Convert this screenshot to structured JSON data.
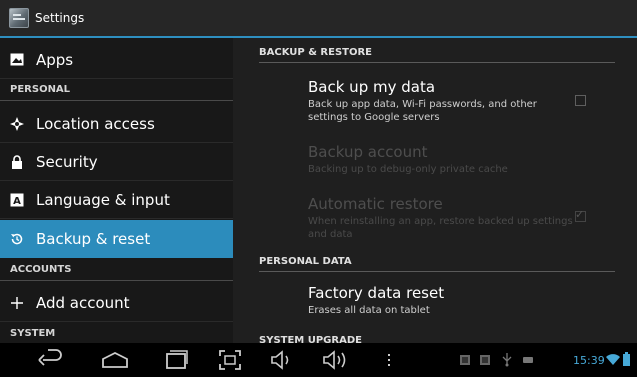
{
  "window": {
    "title": "Settings",
    "icon": "settings-app-icon"
  },
  "sidebar": {
    "items": [
      {
        "kind": "item",
        "label": "Apps",
        "icon": "apps-icon"
      },
      {
        "kind": "header",
        "label": "PERSONAL"
      },
      {
        "kind": "item",
        "label": "Location access",
        "icon": "location-icon"
      },
      {
        "kind": "item",
        "label": "Security",
        "icon": "lock-icon"
      },
      {
        "kind": "item",
        "label": "Language & input",
        "icon": "language-icon"
      },
      {
        "kind": "item",
        "label": "Backup & reset",
        "icon": "backup-icon",
        "selected": true
      },
      {
        "kind": "header",
        "label": "ACCOUNTS"
      },
      {
        "kind": "item",
        "label": "Add account",
        "icon": "plus-icon"
      },
      {
        "kind": "header",
        "label": "SYSTEM"
      }
    ]
  },
  "content": {
    "sections": [
      {
        "header": "BACKUP & RESTORE",
        "entries": [
          {
            "title": "Back up my data",
            "summary": "Back up app data, Wi-Fi passwords, and other settings to Google servers",
            "checkbox": true,
            "checked": false,
            "enabled": true
          },
          {
            "title": "Backup account",
            "summary": "Backing up to debug-only private cache",
            "checkbox": false,
            "enabled": false
          },
          {
            "title": "Automatic restore",
            "summary": "When reinstalling an app, restore backed up settings and data",
            "checkbox": true,
            "checked": true,
            "enabled": false
          }
        ]
      },
      {
        "header": "PERSONAL DATA",
        "entries": [
          {
            "title": "Factory data reset",
            "summary": "Erases all data on tablet",
            "enabled": true
          }
        ]
      },
      {
        "header": "SYSTEM UPGRADE"
      }
    ]
  },
  "navbar": {
    "buttons": [
      "back-icon",
      "home-icon",
      "recent-apps-icon",
      "screenshot-icon",
      "volume-down-icon",
      "volume-up-icon",
      "menu-icon"
    ],
    "status": {
      "time": "15:39",
      "icons": [
        "notification-icon",
        "notification-icon",
        "usb-icon",
        "notification-icon",
        "wifi-icon",
        "battery-icon"
      ]
    },
    "accent": "#33b5e5"
  }
}
